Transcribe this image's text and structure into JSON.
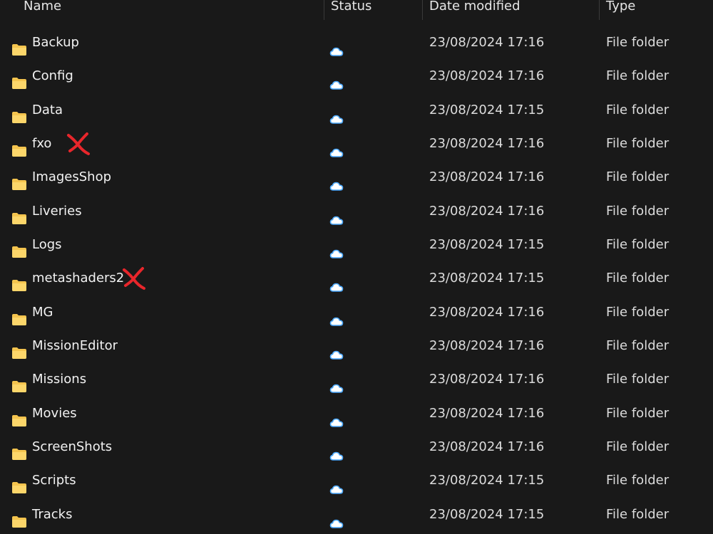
{
  "columns": {
    "name": "Name",
    "status": "Status",
    "date_modified": "Date modified",
    "type": "Type"
  },
  "colors": {
    "background": "#191919",
    "folder": "#f4c44e",
    "cloud_outline": "#4aa8ff",
    "mark": "#e8262b"
  },
  "status_icon": "cloud-icon",
  "rows": [
    {
      "name": "Backup",
      "date": "23/08/2024 17:16",
      "type": "File folder"
    },
    {
      "name": "Config",
      "date": "23/08/2024 17:16",
      "type": "File folder"
    },
    {
      "name": "Data",
      "date": "23/08/2024 17:15",
      "type": "File folder"
    },
    {
      "name": "fxo",
      "date": "23/08/2024 17:16",
      "type": "File folder",
      "marked": true
    },
    {
      "name": "ImagesShop",
      "date": "23/08/2024 17:16",
      "type": "File folder"
    },
    {
      "name": "Liveries",
      "date": "23/08/2024 17:16",
      "type": "File folder"
    },
    {
      "name": "Logs",
      "date": "23/08/2024 17:15",
      "type": "File folder"
    },
    {
      "name": "metashaders2",
      "date": "23/08/2024 17:15",
      "type": "File folder",
      "marked": true
    },
    {
      "name": "MG",
      "date": "23/08/2024 17:16",
      "type": "File folder"
    },
    {
      "name": "MissionEditor",
      "date": "23/08/2024 17:16",
      "type": "File folder"
    },
    {
      "name": "Missions",
      "date": "23/08/2024 17:16",
      "type": "File folder"
    },
    {
      "name": "Movies",
      "date": "23/08/2024 17:16",
      "type": "File folder"
    },
    {
      "name": "ScreenShots",
      "date": "23/08/2024 17:16",
      "type": "File folder"
    },
    {
      "name": "Scripts",
      "date": "23/08/2024 17:15",
      "type": "File folder"
    },
    {
      "name": "Tracks",
      "date": "23/08/2024 17:15",
      "type": "File folder"
    }
  ]
}
